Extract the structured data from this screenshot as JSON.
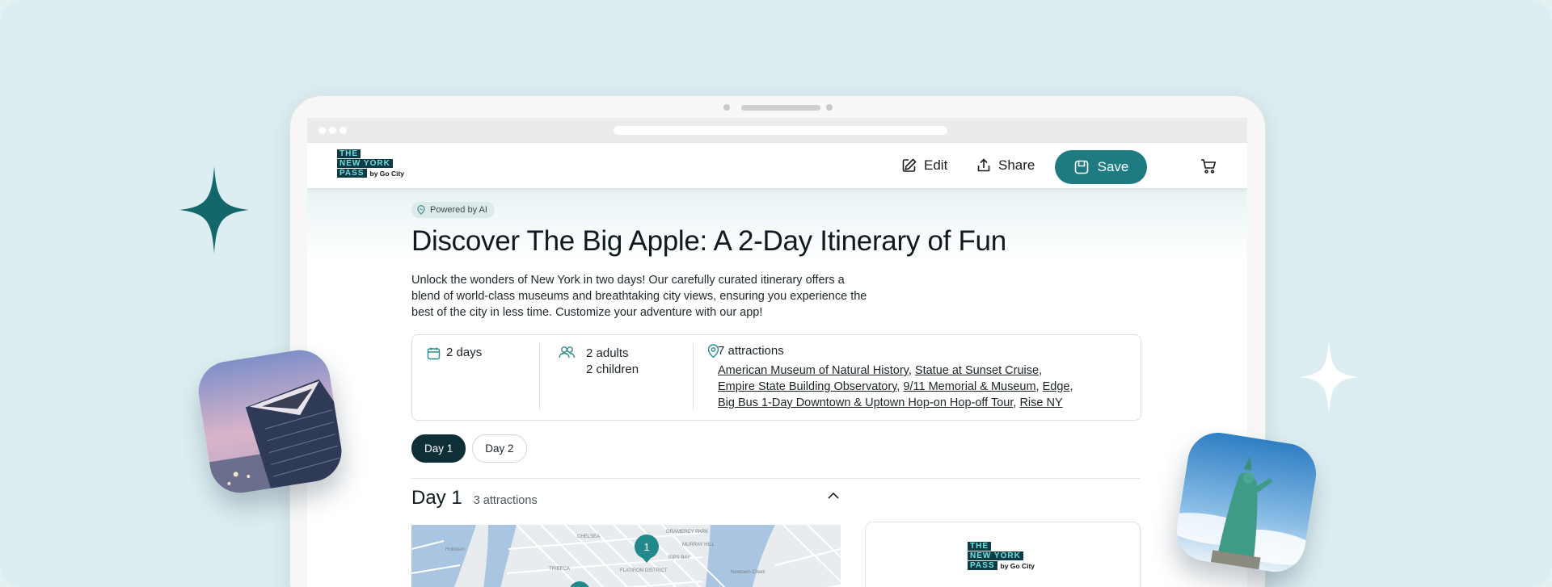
{
  "header": {
    "logo": {
      "line1": "THE",
      "line2": "NEW YORK",
      "line3": "PASS",
      "by": "by Go City"
    },
    "edit_label": "Edit",
    "share_label": "Share",
    "save_label": "Save"
  },
  "badge": {
    "label": "Powered by AI"
  },
  "itinerary": {
    "title": "Discover The Big Apple: A 2-Day Itinerary of Fun",
    "description": "Unlock the wonders of New York in two days! Our carefully curated itinerary offers a blend of world-class museums and breathtaking city views, ensuring you experience the best of the city in less time. Customize your adventure with our app!",
    "duration": "2 days",
    "adults": "2 adults",
    "children": "2 children",
    "attractions_count": "7 attractions",
    "attractions": [
      "American Museum of Natural History",
      "Statue at Sunset Cruise",
      "Empire State Building Observatory",
      "9/11 Memorial & Museum",
      "Edge",
      "Big Bus 1-Day Downtown & Uptown Hop-on Hop-off Tour",
      "Rise NY"
    ]
  },
  "day_tabs": [
    {
      "label": "Day 1",
      "active": true
    },
    {
      "label": "Day 2",
      "active": false
    }
  ],
  "day_section": {
    "title": "Day 1",
    "count": "3 attractions"
  },
  "map": {
    "pin_label": "1",
    "place_labels": [
      "Hoboken",
      "CHELSEA",
      "GRAMERCY PARK",
      "FLATIRON DISTRICT",
      "KIPS BAY",
      "MURRAY HILL",
      "TRIBECA",
      "Newtown Creek"
    ]
  },
  "colors": {
    "brand_teal": "#1f7b82",
    "logo_navy": "#0f3b47",
    "logo_cyan": "#6fe0dc",
    "background": "#dceef1"
  },
  "icons": [
    "edit-icon",
    "share-icon",
    "save-icon",
    "cart-icon",
    "sparkle-icon",
    "calendar-icon",
    "people-icon",
    "location-pin-icon",
    "chevron-up-icon"
  ]
}
